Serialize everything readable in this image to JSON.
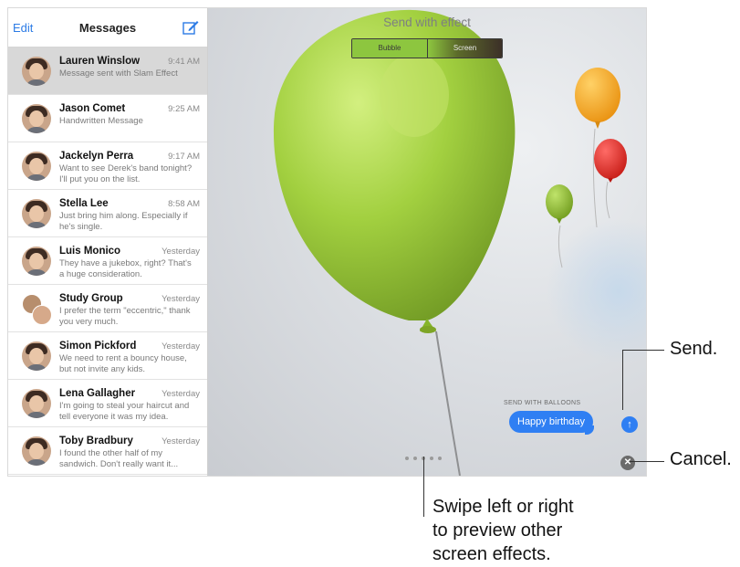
{
  "sidebar": {
    "edit_label": "Edit",
    "title": "Messages",
    "conversations": [
      {
        "name": "Lauren Winslow",
        "time": "9:41 AM",
        "preview": "Message sent with Slam Effect",
        "selected": true
      },
      {
        "name": "Jason Comet",
        "time": "9:25 AM",
        "preview": "Handwritten Message"
      },
      {
        "name": "Jackelyn Perra",
        "time": "9:17 AM",
        "preview": "Want to see Derek's band tonight? I'll put you on the list."
      },
      {
        "name": "Stella Lee",
        "time": "8:58 AM",
        "preview": "Just bring him along. Especially if he's single."
      },
      {
        "name": "Luis Monico",
        "time": "Yesterday",
        "preview": "They have a jukebox, right? That's a huge consideration."
      },
      {
        "name": "Study Group",
        "time": "Yesterday",
        "preview": "I prefer the term \"eccentric,\" thank you very much."
      },
      {
        "name": "Simon Pickford",
        "time": "Yesterday",
        "preview": "We need to rent a bouncy house, but not invite any kids."
      },
      {
        "name": "Lena Gallagher",
        "time": "Yesterday",
        "preview": "I'm going to steal your haircut and tell everyone it was my idea."
      },
      {
        "name": "Toby Bradbury",
        "time": "Yesterday",
        "preview": "I found the other half of my sandwich. Don't really want it..."
      }
    ]
  },
  "main": {
    "title": "Send with effect",
    "tabs": [
      {
        "label": "Bubble"
      },
      {
        "label": "Screen"
      }
    ],
    "caption": "SEND WITH BALLOONS",
    "message": "Happy birthday",
    "send_icon": "↑",
    "cancel_icon": "✕"
  },
  "callouts": {
    "send": "Send.",
    "cancel": "Cancel.",
    "swipe": [
      "Swipe left or right",
      "to preview other",
      "screen effects."
    ]
  },
  "colors": {
    "accent": "#2f7ff3",
    "balloon_green": "#8dc63f",
    "balloon_orange": "#f5a623",
    "balloon_red": "#e0302b"
  }
}
